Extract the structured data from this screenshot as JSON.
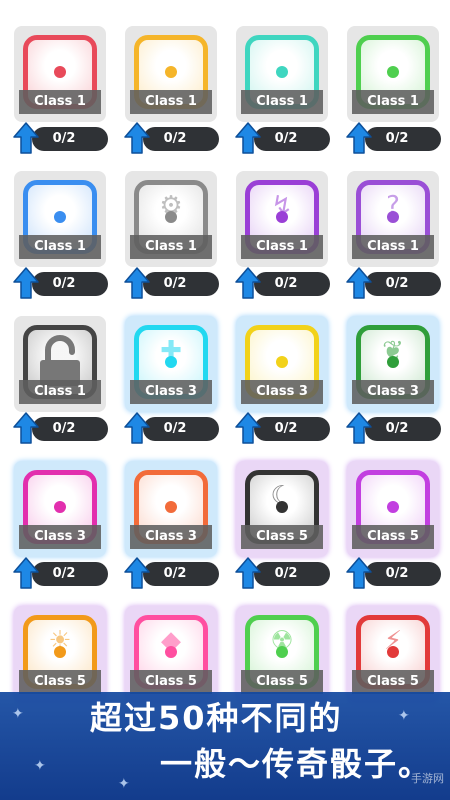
{
  "dice_grid": [
    {
      "label": "Class 1",
      "progress": "0/2",
      "color": "#e84a5a",
      "symbol": "",
      "tier": 1
    },
    {
      "label": "Class 1",
      "progress": "0/2",
      "color": "#f5b52a",
      "symbol": "",
      "tier": 1
    },
    {
      "label": "Class 1",
      "progress": "0/2",
      "color": "#3fd6c0",
      "symbol": "",
      "tier": 1
    },
    {
      "label": "Class 1",
      "progress": "0/2",
      "color": "#4fcf4f",
      "symbol": "",
      "tier": 1
    },
    {
      "label": "Class 1",
      "progress": "0/2",
      "color": "#3a8ef0",
      "symbol": "",
      "tier": 1
    },
    {
      "label": "Class 1",
      "progress": "0/2",
      "color": "#8a8a8a",
      "symbol": "gear",
      "tier": 1
    },
    {
      "label": "Class 1",
      "progress": "0/2",
      "color": "#9a3fd6",
      "symbol": "arrows",
      "tier": 1
    },
    {
      "label": "Class 1",
      "progress": "0/2",
      "color": "#9a4fd6",
      "symbol": "question",
      "tier": 1
    },
    {
      "label": "Class 1",
      "progress": "0/2",
      "color": "#444444",
      "symbol": "lock",
      "tier": 1
    },
    {
      "label": "Class 3",
      "progress": "0/2",
      "color": "#22d8f0",
      "symbol": "cross",
      "tier": 3
    },
    {
      "label": "Class 3",
      "progress": "0/2",
      "color": "#f2d21a",
      "symbol": "",
      "tier": 3
    },
    {
      "label": "Class 3",
      "progress": "0/2",
      "color": "#2f9e3a",
      "symbol": "vine",
      "tier": 3
    },
    {
      "label": "Class 3",
      "progress": "0/2",
      "color": "#e22fae",
      "symbol": "",
      "tier": 3
    },
    {
      "label": "Class 3",
      "progress": "0/2",
      "color": "#f26b3a",
      "symbol": "",
      "tier": 3
    },
    {
      "label": "Class 5",
      "progress": "0/2",
      "color": "#333333",
      "symbol": "scythe",
      "tier": 5
    },
    {
      "label": "Class 5",
      "progress": "0/2",
      "color": "#c23fe0",
      "symbol": "",
      "tier": 5
    },
    {
      "label": "Class 5",
      "progress": "",
      "color": "#f29a1a",
      "symbol": "sun",
      "tier": 5
    },
    {
      "label": "Class 5",
      "progress": "",
      "color": "#ff4fa0",
      "symbol": "gem",
      "tier": 5
    },
    {
      "label": "Class 5",
      "progress": "",
      "color": "#4fcf4f",
      "symbol": "radiation",
      "tier": 5
    },
    {
      "label": "Class 5",
      "progress": "",
      "color": "#e23a3a",
      "symbol": "lightning",
      "tier": 5
    }
  ],
  "banner": {
    "line1": "超过50种不同的",
    "line2": "一般～传奇骰子。"
  },
  "watermark": "手游网",
  "colors": {
    "arrow": "#1e88e5",
    "pill": "#2f3236",
    "banner": "#1448a0"
  }
}
